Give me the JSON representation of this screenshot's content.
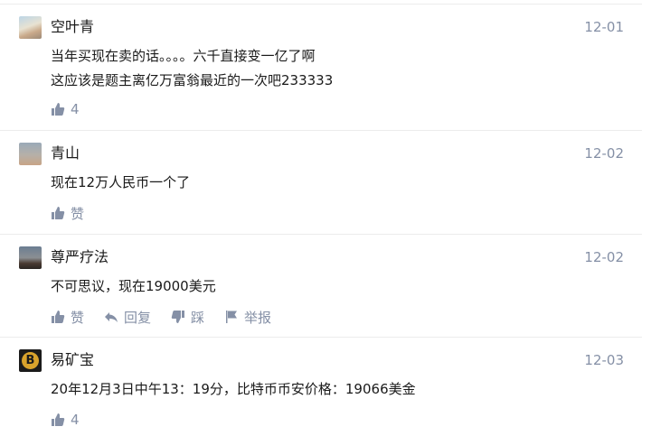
{
  "comments": [
    {
      "name": "空叶青",
      "time": "12-01",
      "lines": [
        "当年买现在卖的话。。。。六千直接变一亿了啊",
        "这应该是题主离亿万富翁最近的一次吧233333"
      ],
      "like_label": "4",
      "avatar": "landscape-avatar"
    },
    {
      "name": "青山",
      "time": "12-02",
      "lines": [
        "现在12万人民币一个了"
      ],
      "like_label": "赞",
      "avatar": "sky-avatar"
    },
    {
      "name": "尊严疗法",
      "time": "12-02",
      "lines": [
        "不可思议，现在19000美元"
      ],
      "like_label": "赞",
      "reply_label": "回复",
      "dislike_label": "踩",
      "report_label": "举报",
      "avatar": "sunset-avatar"
    },
    {
      "name": "易矿宝",
      "time": "12-03",
      "lines": [
        "20年12月3日中午13：19分，比特币币安价格：19066美金"
      ],
      "like_label": "4",
      "avatar": "bitcoin-avatar",
      "avatar_glyph": "B"
    }
  ]
}
